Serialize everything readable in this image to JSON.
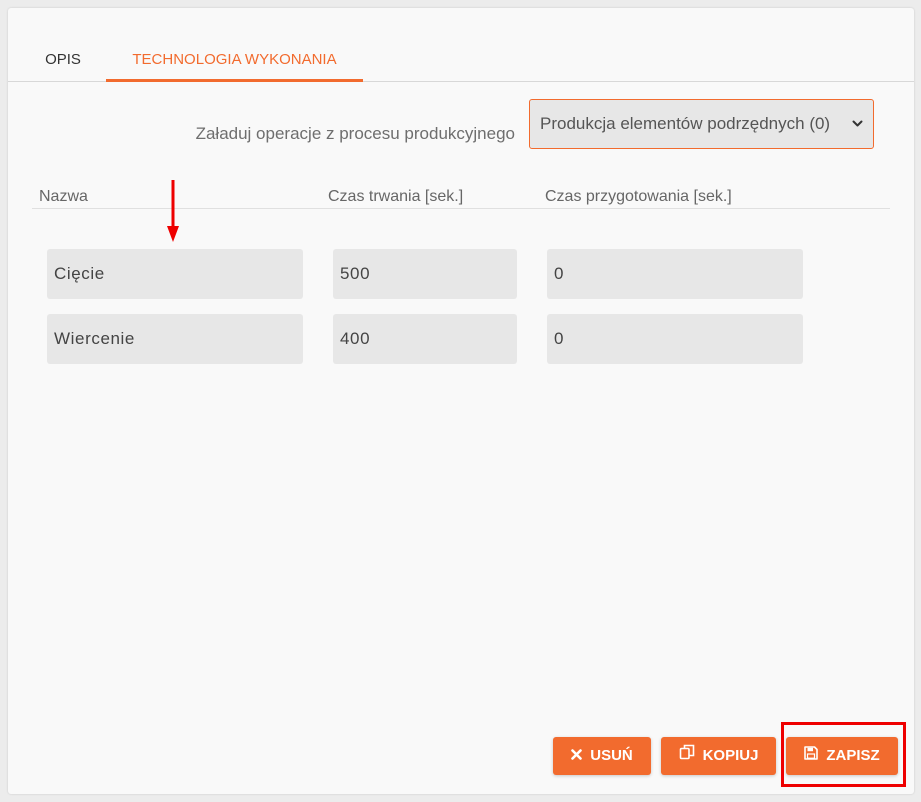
{
  "tabs": [
    {
      "label": "OPIS",
      "active": false
    },
    {
      "label": "TECHNOLOGIA WYKONANIA",
      "active": true
    }
  ],
  "load": {
    "label": "Załaduj operacje z procesu produkcyjnego",
    "selected": "Produkcja elementów podrzędnych (0)"
  },
  "table": {
    "headers": [
      "Nazwa",
      "Czas trwania [sek.]",
      "Czas przygotowania [sek.]"
    ],
    "rows": [
      [
        "Cięcie",
        "500",
        "0"
      ],
      [
        "Wiercenie",
        "400",
        "0"
      ]
    ]
  },
  "actions": {
    "delete_label": "USUŃ",
    "copy_label": "KOPIUJ",
    "save_label": "ZAPISZ"
  },
  "colors": {
    "accent": "#f26b2e",
    "highlight": "#ee0000",
    "annotation_arrow": "#ee0000"
  },
  "icons": {
    "delete": "close-x-icon",
    "copy": "copy-icon",
    "save": "floppy-disk-icon",
    "select": "chevron-down-icon"
  }
}
